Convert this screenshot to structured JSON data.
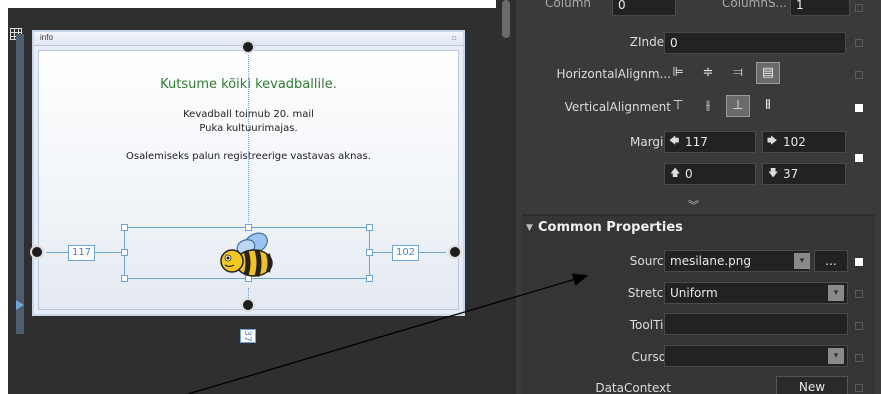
{
  "designer": {
    "window_title": "info",
    "heading": "Kutsume kõiki kevadballile.",
    "line1": "Kevadball toimub 20. mail",
    "line2": "Puka kultuurimajas.",
    "line3": "Osalemiseks palun registreerige  vastavas aknas.",
    "margin_left_badge": "117",
    "margin_right_badge": "102",
    "margin_bottom_badge": "37",
    "image_icon": "bee-icon"
  },
  "properties": {
    "column_label": "Column",
    "column_value": "0",
    "columnspan_label": "ColumnS...",
    "columnspan_value": "1",
    "zindex_label": "ZIndex",
    "zindex_value": "0",
    "halign_label": "HorizontalAlignm...",
    "valign_label": "VerticalAlignment",
    "margin_label": "Margin",
    "margin_left": "117",
    "margin_right": "102",
    "margin_top": "0",
    "margin_bottom": "37",
    "section_title": "Common Properties",
    "source_label": "Source",
    "source_value": "mesilane.png",
    "browse_label": "...",
    "stretch_label": "Stretch",
    "stretch_value": "Uniform",
    "tooltip_label": "ToolTip",
    "tooltip_value": "",
    "cursor_label": "Cursor",
    "cursor_value": "",
    "datacontext_label": "DataContext",
    "new_button": "New"
  },
  "colors": {
    "panel_bg": "#3a3a3a",
    "field_bg": "#222222",
    "accent_blue": "#6aa6d8",
    "heading_green": "#2e7d2e"
  }
}
